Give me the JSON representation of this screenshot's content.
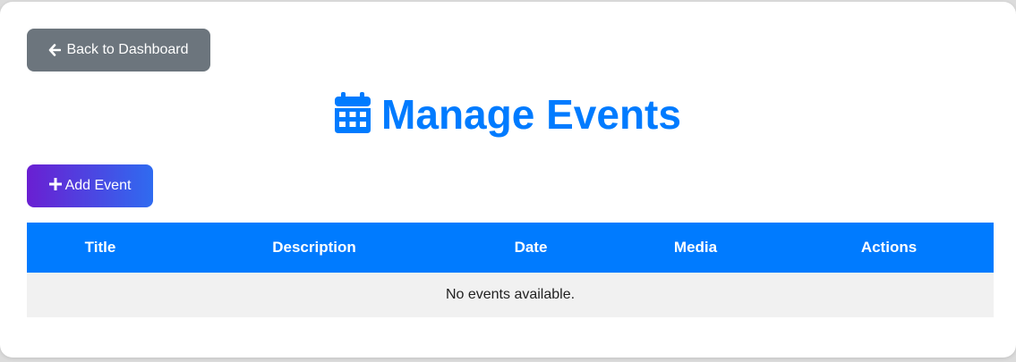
{
  "back_button": {
    "label": "Back to Dashboard",
    "icon": "arrow-left-icon"
  },
  "page": {
    "title": "Manage Events",
    "title_icon": "calendar-icon",
    "accent_color": "#007bff"
  },
  "add_button": {
    "label": "Add Event",
    "icon": "plus-icon"
  },
  "table": {
    "columns": [
      "Title",
      "Description",
      "Date",
      "Media",
      "Actions"
    ],
    "empty_message": "No events available."
  }
}
